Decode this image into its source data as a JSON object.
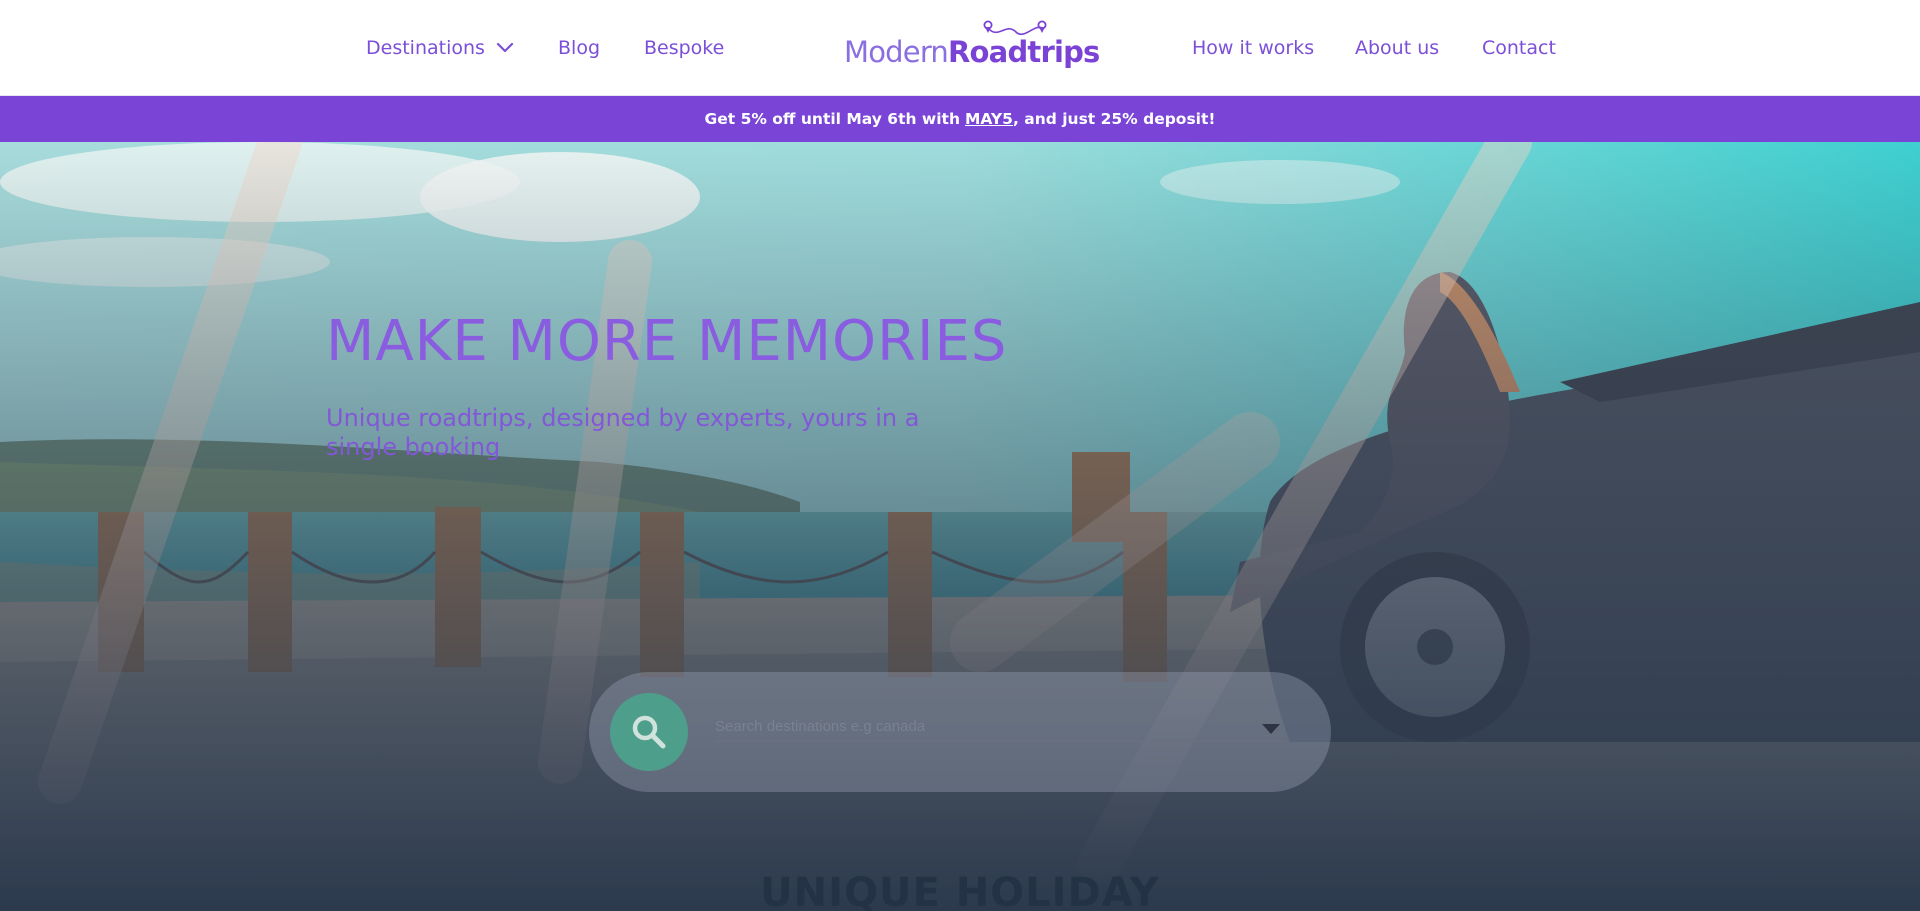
{
  "header": {
    "nav_left": [
      {
        "label": "Destinations",
        "has_dropdown": true
      },
      {
        "label": "Blog"
      },
      {
        "label": "Bespoke"
      }
    ],
    "logo": {
      "word_1": "Modern",
      "word_2": "Roadtrips"
    },
    "nav_right": [
      {
        "label": "How it works"
      },
      {
        "label": "About us"
      },
      {
        "label": "Contact"
      }
    ]
  },
  "promo": {
    "text_before": "Get 5% off until May 6th with",
    "code": "MAY5",
    "text_after": ", and just 25% deposit!"
  },
  "hero": {
    "title": "MAKE MORE MEMORIES",
    "subtitle": "Unique roadtrips, designed by experts, yours in a single booking"
  },
  "search": {
    "placeholder": "Search destinations e.g canada",
    "button_icon": "search-icon",
    "dropdown_icon": "caret-down-icon"
  },
  "section": {
    "heading": "UNIQUE HOLIDAY"
  },
  "colors": {
    "brand_purple": "#7a45d7",
    "nav_text": "#7b4fd8",
    "search_button": "#4e9e8c"
  }
}
